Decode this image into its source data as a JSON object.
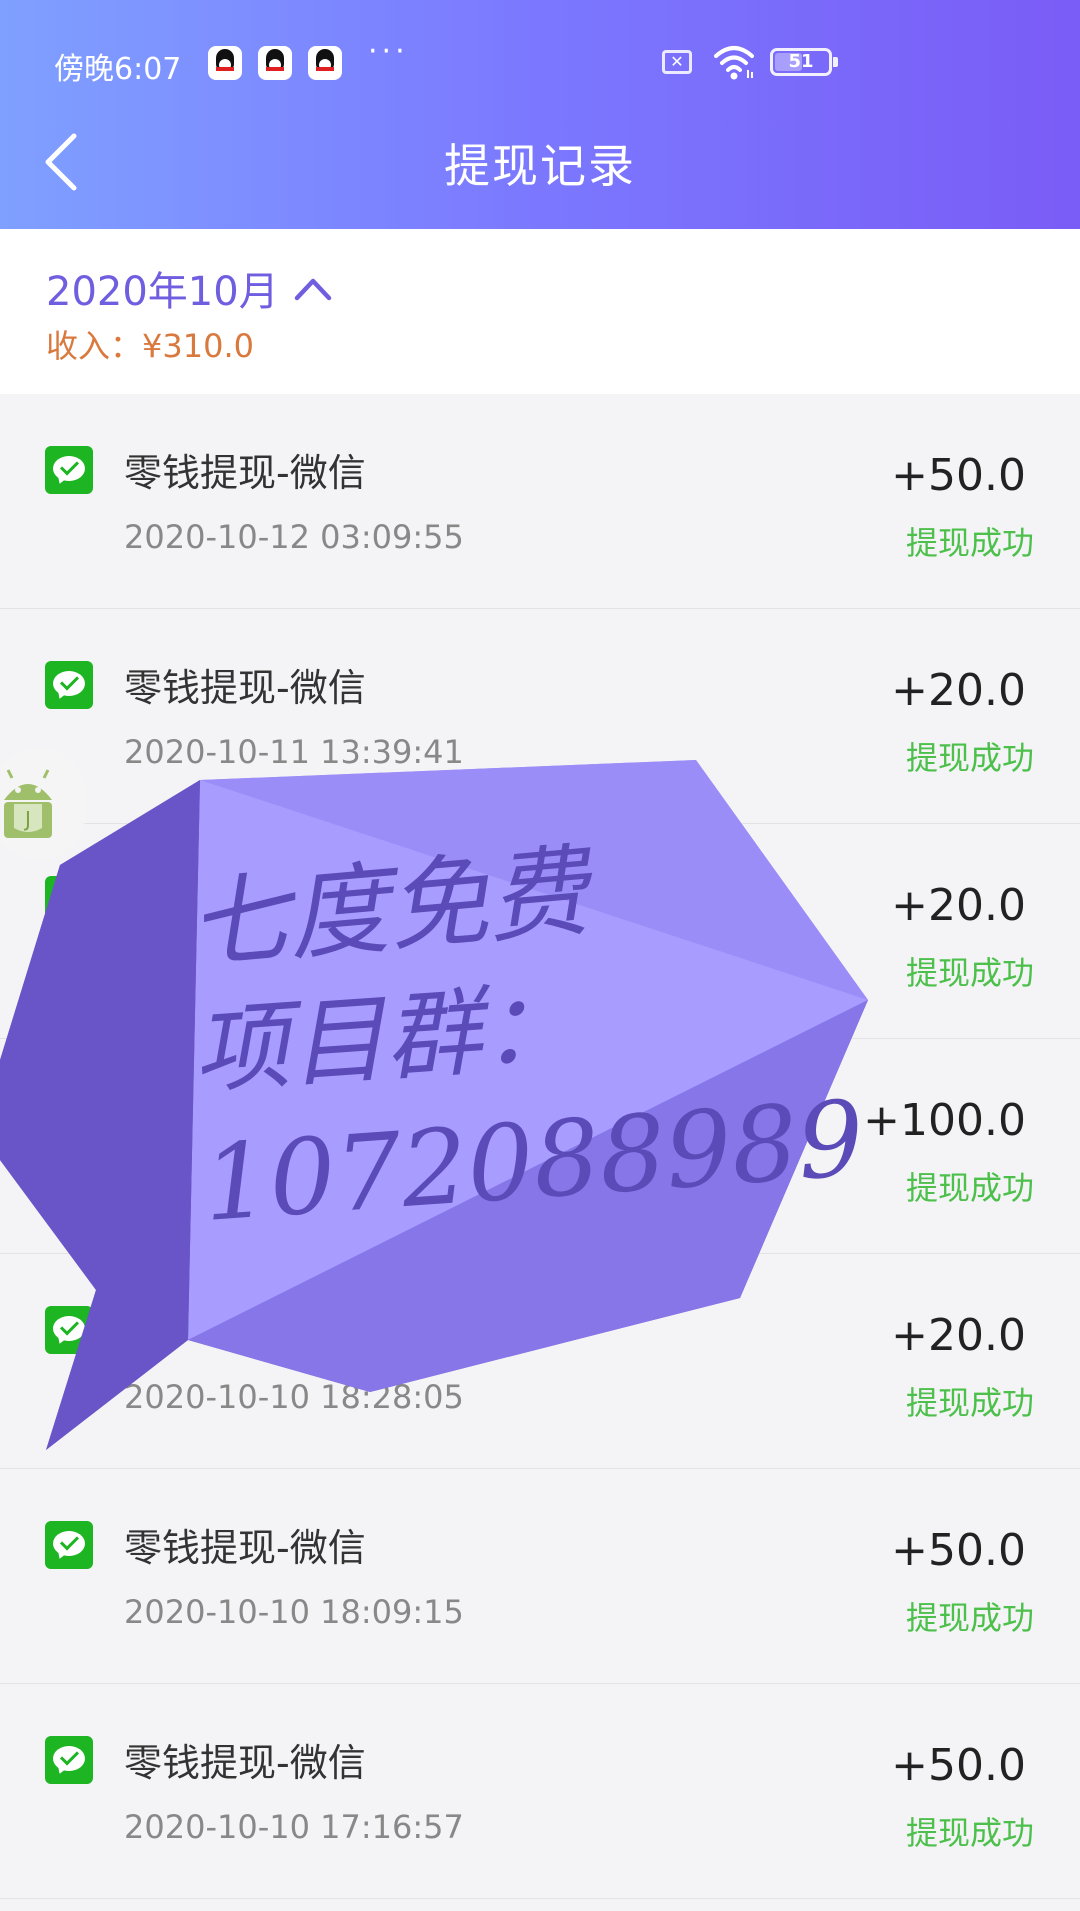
{
  "status_bar": {
    "time": "傍晚6:07",
    "more": "···",
    "battery_level": "51",
    "battery_fraction": 0.51,
    "sim_mark": "✕",
    "icons": [
      "qq-icon",
      "qq-icon",
      "qq-icon",
      "no-sim-icon",
      "wifi-icon",
      "battery-icon"
    ]
  },
  "header": {
    "title": "提现记录",
    "back_icon": "chevron-left-icon"
  },
  "month": {
    "label": "2020年10月",
    "income_label": "收入：",
    "income_value": "¥310.0",
    "toggle_icon": "chevron-up-icon"
  },
  "colors": {
    "accent_purple": "#6f5ee0",
    "income_orange": "#d9793e",
    "success_green": "#4cc04b",
    "wechat_green": "#1db522",
    "watermark_purple": "#a89cff"
  },
  "records": [
    {
      "title": "零钱提现-微信",
      "time": "2020-10-12 03:09:55",
      "amount": "+50.0",
      "status": "提现成功"
    },
    {
      "title": "零钱提现-微信",
      "time": "2020-10-11 13:39:41",
      "amount": "+20.0",
      "status": "提现成功"
    },
    {
      "title": "",
      "time": "",
      "amount": "+20.0",
      "status": "提现成功"
    },
    {
      "title": "",
      "time": "",
      "amount": "+100.0",
      "status": "提现成功"
    },
    {
      "title": "",
      "time": "2020-10-10 18:28:05",
      "amount": "+20.0",
      "status": "提现成功"
    },
    {
      "title": "零钱提现-微信",
      "time": "2020-10-10 18:09:15",
      "amount": "+50.0",
      "status": "提现成功"
    },
    {
      "title": "零钱提现-微信",
      "time": "2020-10-10 17:16:57",
      "amount": "+50.0",
      "status": "提现成功"
    }
  ],
  "watermark": {
    "lines": [
      "七度免费",
      "项目群：",
      "1072088989"
    ]
  },
  "floating_badge": {
    "icon": "android-icon",
    "letter": "J"
  }
}
